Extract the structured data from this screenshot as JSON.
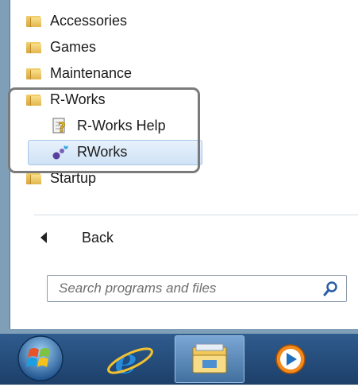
{
  "programs": {
    "items": [
      {
        "label": "Accessories"
      },
      {
        "label": "Games"
      },
      {
        "label": "Maintenance"
      },
      {
        "label": "R-Works"
      }
    ],
    "rworks_subitems": [
      {
        "label": "R-Works Help"
      },
      {
        "label": "RWorks"
      }
    ],
    "startup": {
      "label": "Startup"
    }
  },
  "back": {
    "label": "Back"
  },
  "search": {
    "placeholder": "Search programs and files"
  },
  "taskbar": {
    "items": [
      "windows-orb",
      "internet-explorer",
      "windows-explorer",
      "media-player"
    ]
  },
  "colors": {
    "selection": "#cfe2f6",
    "highlight_frame": "#7b7b7b",
    "taskbar": "#2f5c8e"
  }
}
